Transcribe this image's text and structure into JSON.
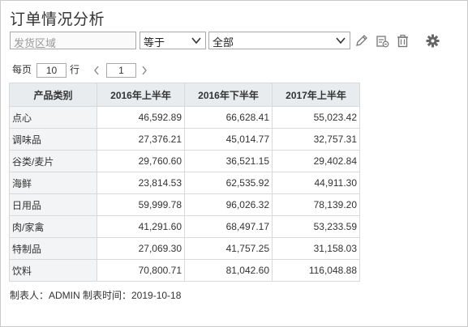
{
  "title": "订单情况分析",
  "filter": {
    "area_placeholder": "发货区域",
    "operator_value": "等于",
    "value_value": "全部"
  },
  "icons": {
    "edit": "pencil-icon",
    "clear": "clear-filter-icon",
    "delete": "trash-icon",
    "settings": "gear-icon"
  },
  "pager": {
    "per_page_label": "每页",
    "per_page_value": "10",
    "rows_label": "行",
    "page_value": "1"
  },
  "table": {
    "headers": [
      "产品类别",
      "2016年上半年",
      "2016年下半年",
      "2017年上半年"
    ],
    "rows": [
      [
        "点心",
        "46,592.89",
        "66,628.41",
        "55,023.42"
      ],
      [
        "调味品",
        "27,376.21",
        "45,014.77",
        "32,757.31"
      ],
      [
        "谷类/麦片",
        "29,760.60",
        "36,521.15",
        "29,402.84"
      ],
      [
        "海鲜",
        "23,814.53",
        "62,535.92",
        "44,911.30"
      ],
      [
        "日用品",
        "59,999.78",
        "96,026.32",
        "78,139.20"
      ],
      [
        "肉/家禽",
        "41,291.60",
        "68,497.17",
        "53,233.59"
      ],
      [
        "特制品",
        "27,069.30",
        "41,757.25",
        "31,158.03"
      ],
      [
        "饮料",
        "70,800.71",
        "81,042.60",
        "116,048.88"
      ]
    ]
  },
  "footer": "制表人：ADMIN  制表时间：2019-10-18",
  "colors": {
    "header_bg": "#e8ecef",
    "category_bg": "#f2f4f5",
    "border": "#d6dadd"
  }
}
